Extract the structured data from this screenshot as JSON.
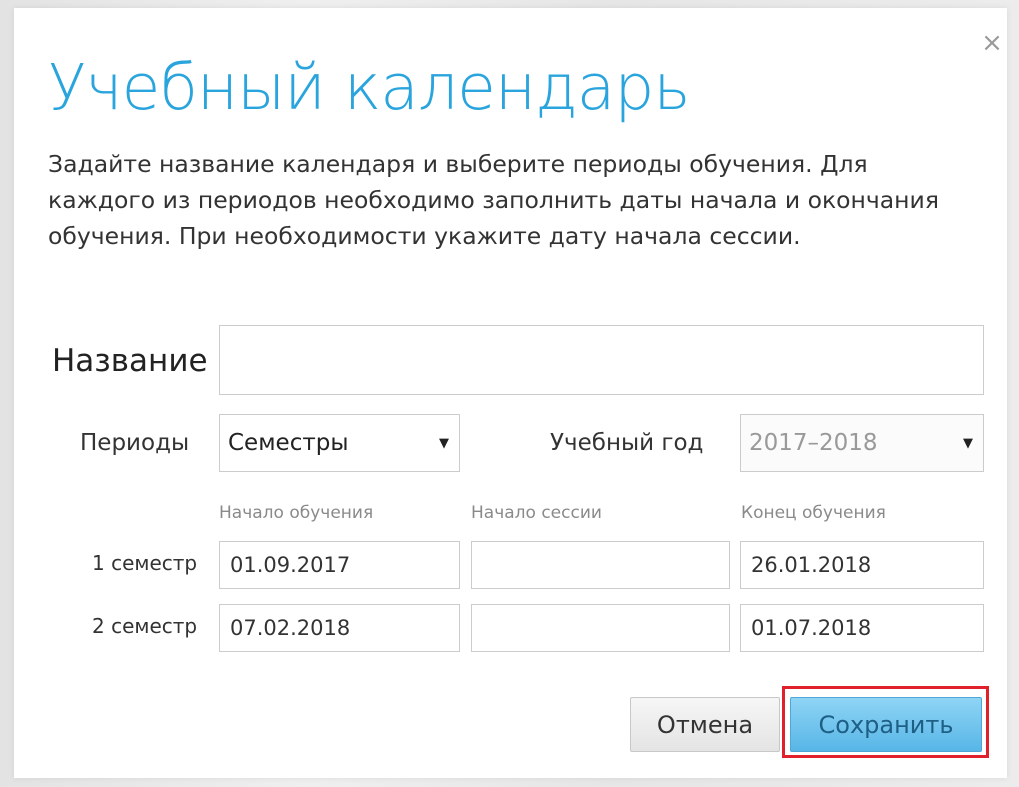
{
  "dialog": {
    "title": "Учебный календарь",
    "description": "Задайте название календаря и выберите периоды обучения. Для каждого из периодов необходимо заполнить даты начала и окончания обучения. При необходимости укажите дату начала сессии.",
    "close_icon": "×"
  },
  "form": {
    "name_label": "Название",
    "name_value": "",
    "periods_label": "Периоды",
    "periods_selected": "Семестры",
    "year_label": "Учебный год",
    "year_selected": "2017–2018",
    "caret": "▼",
    "columns": [
      "Начало обучения",
      "Начало сессии",
      "Конец обучения"
    ],
    "rows": [
      {
        "label": "1 семестр",
        "start": "01.09.2017",
        "session": "",
        "end": "26.01.2018"
      },
      {
        "label": "2 семестр",
        "start": "07.02.2018",
        "session": "",
        "end": "01.07.2018"
      }
    ]
  },
  "buttons": {
    "cancel": "Отмена",
    "save": "Сохранить"
  },
  "colors": {
    "title": "#2aa4dd",
    "save_button": "#57b6e6",
    "highlight": "#e0202a"
  }
}
